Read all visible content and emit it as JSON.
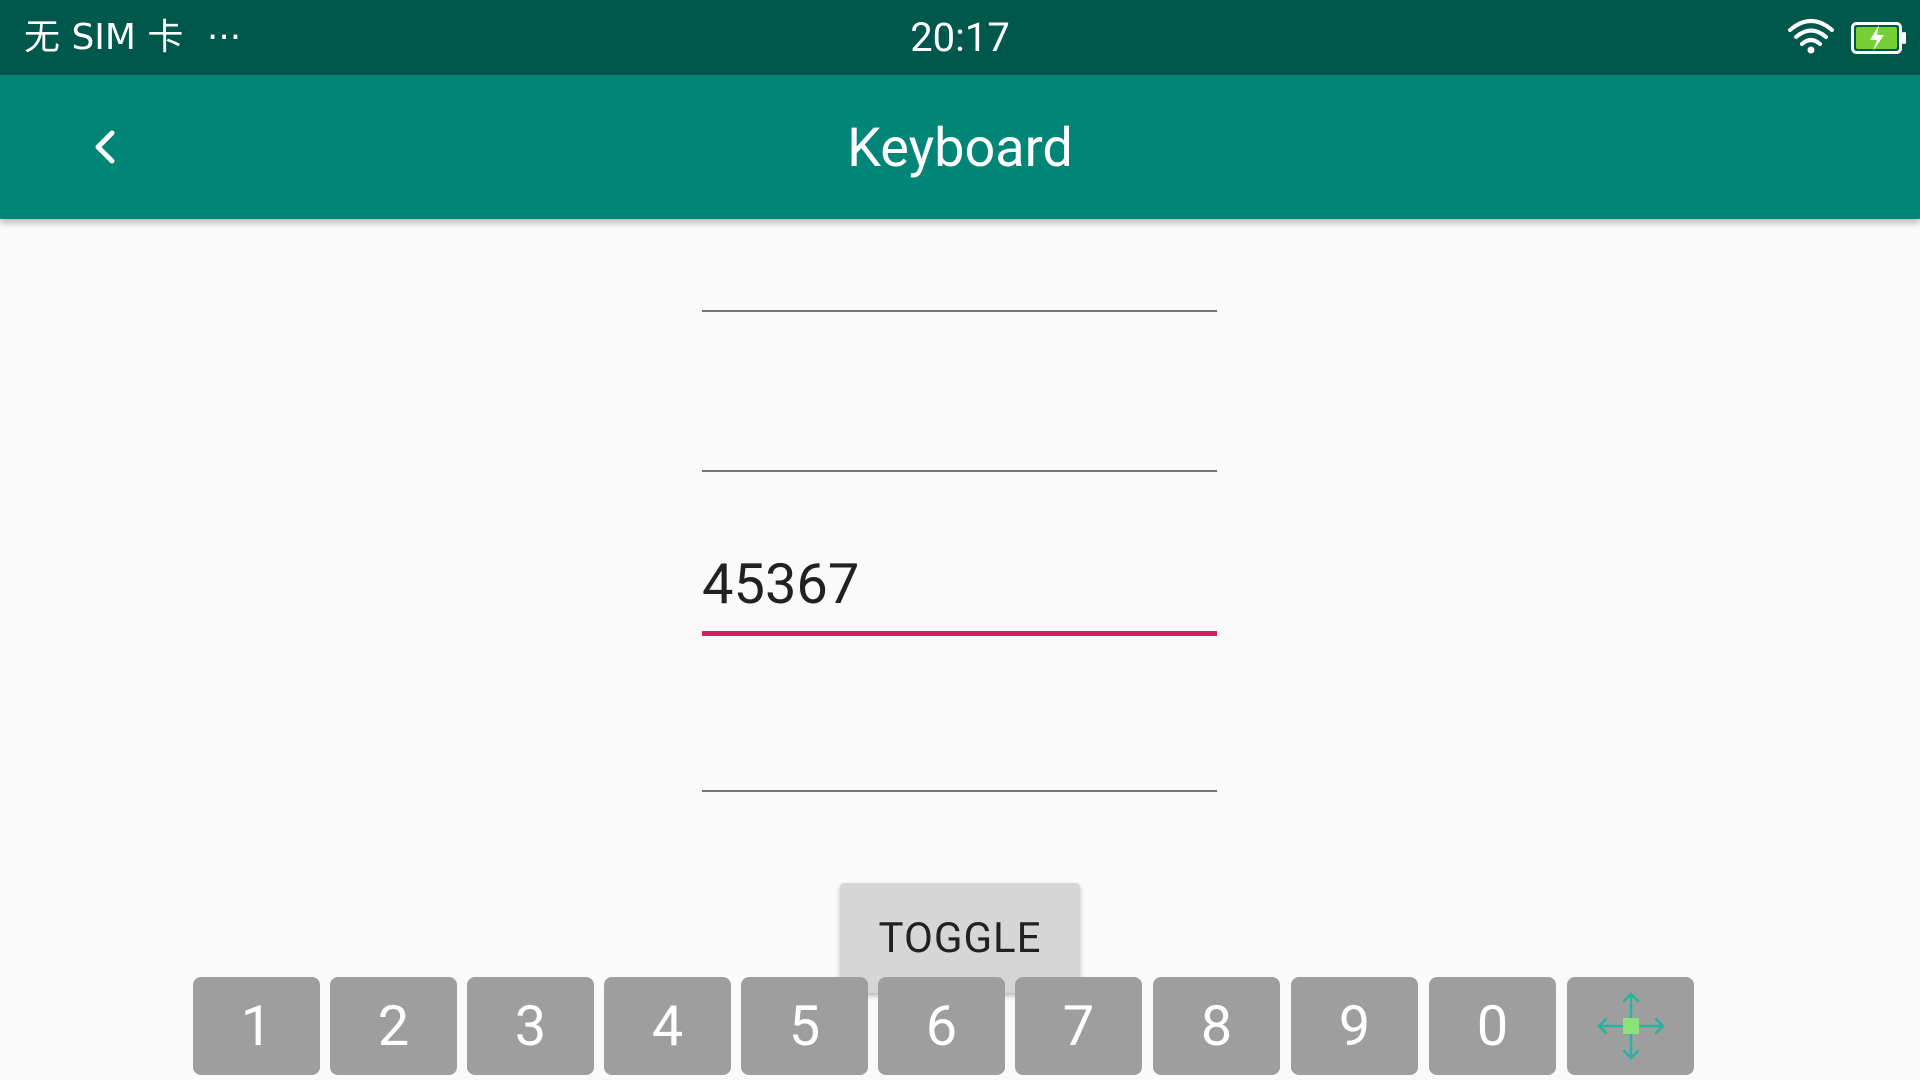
{
  "status_bar": {
    "carrier": "无 SIM 卡",
    "more": "···",
    "time": "20:17",
    "icons": [
      "wifi-icon",
      "battery-charging-icon"
    ]
  },
  "app_bar": {
    "title": "Keyboard",
    "back_icon": "back-arrow-icon"
  },
  "fields": [
    {
      "value": "",
      "focused": false
    },
    {
      "value": "",
      "focused": false
    },
    {
      "value": "45367",
      "focused": true
    },
    {
      "value": "",
      "focused": false
    }
  ],
  "toggle_label": "TOGGLE",
  "keyboard": {
    "keys": [
      "1",
      "2",
      "3",
      "4",
      "5",
      "6",
      "7",
      "8",
      "9",
      "0"
    ],
    "move_key_icon": "move-icon"
  },
  "colors": {
    "status_bar": "#00574b",
    "app_bar": "#008577",
    "accent": "#d81b60",
    "key_background": "#9e9e9e"
  }
}
